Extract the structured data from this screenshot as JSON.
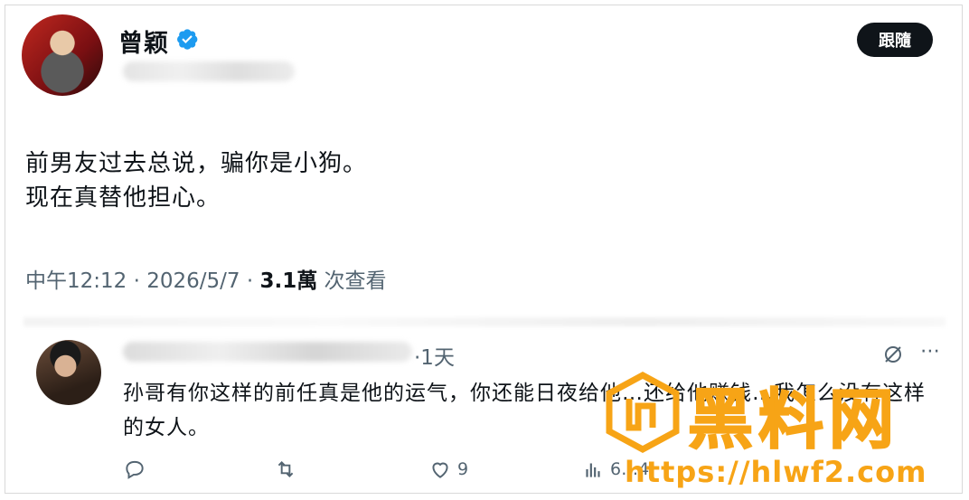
{
  "post": {
    "author_name": "曾颖",
    "follow_label": "跟隨",
    "text_lines": [
      "前男友过去总说，骗你是小狗。",
      "现在真替他担心。"
    ],
    "time": "中午12:12",
    "date": "2026/5/7",
    "views_count": "3.1萬",
    "views_label": "次查看",
    "sep": "·"
  },
  "reply": {
    "time": "·1天",
    "text": "孙哥有你这样的前任真是他的运气，你还能日夜给他…还给他赚钱…我怎么没有这样的女人。",
    "actions": {
      "likes": "9",
      "views": "6…4"
    }
  },
  "watermark": {
    "title": "黑料网",
    "url": "https://hlwf2.com",
    "color": "#f7a416"
  },
  "icons": {
    "verified": "verified-badge-icon",
    "grok": "grok-icon",
    "more": "more-icon",
    "reply": "reply-icon",
    "repost": "repost-icon",
    "like": "like-icon",
    "views": "views-icon",
    "bookmark": "bookmark-icon",
    "share": "share-icon"
  },
  "colors": {
    "accent": "#1d9bf0",
    "text": "#0f1419",
    "muted": "#536471"
  }
}
